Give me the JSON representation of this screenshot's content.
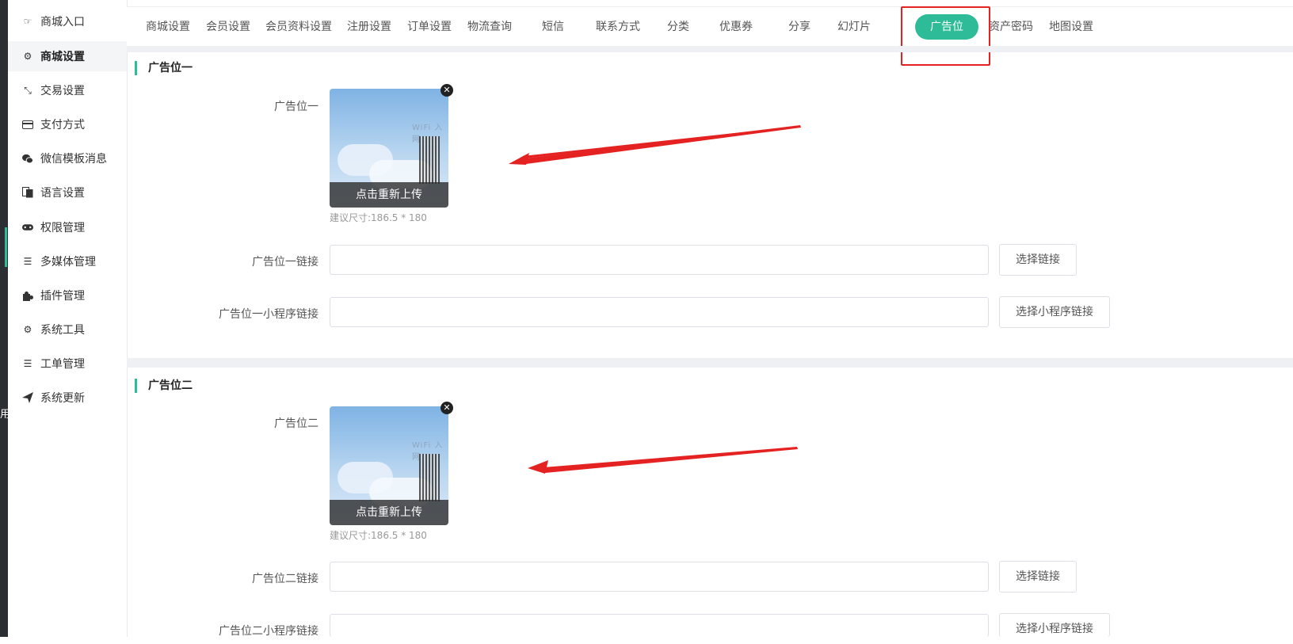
{
  "edge_char": "用",
  "sidebar": {
    "items": [
      {
        "label": "商城入口",
        "icon": "hand-pointer-icon"
      },
      {
        "label": "商城设置",
        "icon": "gear-icon"
      },
      {
        "label": "交易设置",
        "icon": "compress-arrows-icon"
      },
      {
        "label": "支付方式",
        "icon": "credit-card-icon"
      },
      {
        "label": "微信模板消息",
        "icon": "wechat-icon"
      },
      {
        "label": "语言设置",
        "icon": "language-icon"
      },
      {
        "label": "权限管理",
        "icon": "gamepad-icon"
      },
      {
        "label": "多媒体管理",
        "icon": "list-icon"
      },
      {
        "label": "插件管理",
        "icon": "puzzle-icon"
      },
      {
        "label": "系统工具",
        "icon": "gear-icon"
      },
      {
        "label": "工单管理",
        "icon": "list-icon"
      },
      {
        "label": "系统更新",
        "icon": "paper-plane-icon"
      }
    ]
  },
  "tabs": [
    "商城设置",
    "会员设置",
    "会员资料设置",
    "注册设置",
    "订单设置",
    "物流查询",
    "短信",
    "联系方式",
    "分类",
    "优惠券",
    "分享",
    "幻灯片",
    "广告位",
    "资产密码",
    "地图设置"
  ],
  "sections": [
    {
      "title": "广告位一",
      "image_label": "广告位一",
      "reupload": "点击重新上传",
      "hint": "建议尺寸:186.5 * 180",
      "link_label": "广告位一链接",
      "link_value": "",
      "link_button": "选择链接",
      "mini_label": "广告位一小程序链接",
      "mini_value": "",
      "mini_button": "选择小程序链接"
    },
    {
      "title": "广告位二",
      "image_label": "广告位二",
      "reupload": "点击重新上传",
      "hint": "建议尺寸:186.5 * 180",
      "link_label": "广告位二链接",
      "link_value": "",
      "link_button": "选择链接",
      "mini_label": "广告位二小程序链接",
      "mini_value": "",
      "mini_button": "选择小程序链接"
    }
  ],
  "image_overlay_text": "WiFi 入网",
  "colors": {
    "accent": "#2ebc98",
    "annotation": "#e52222"
  }
}
